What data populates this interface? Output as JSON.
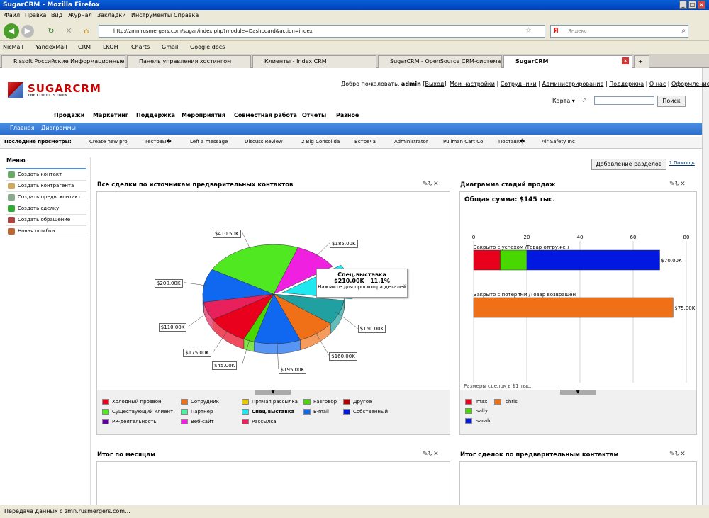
{
  "window": {
    "title": "SugarCRM - Mozilla Firefox"
  },
  "menu": [
    "Файл",
    "Правка",
    "Вид",
    "Журнал",
    "Закладки",
    "Инструменты",
    "Справка"
  ],
  "address": {
    "url": "http://zmn.rusmergers.com/sugar/index.php?module=Dashboard&action=index",
    "search_placeholder": "Яндекс"
  },
  "bookmarks": [
    "NicMail",
    "YandexMail",
    "CRM",
    "LKOH",
    "Charts",
    "Gmail",
    "Google docs"
  ],
  "tabs": [
    "Rissoft Российские Информационные ...",
    "Панель управления хостингом",
    "Клиенты - Index.CRM",
    "SugarCRM - OpenSource CRM-система",
    "SugarCRM"
  ],
  "header": {
    "logo_text": "SUGARCRM",
    "logo_tagline": "THE CLOUD IS OPEN",
    "welcome": "Добро пожаловать, ",
    "user": "admin",
    "logout": "Выход",
    "links": [
      "Мои настройки",
      "Сотрудники",
      "Администрирование",
      "Поддержка",
      "О нас",
      "Оформление"
    ],
    "map_label": "Карта",
    "search_button": "Поиск"
  },
  "mainnav": [
    "Продажи",
    "Маркетинг",
    "Поддержка",
    "Мероприятия",
    "Совместная работа",
    "Отчеты",
    "Разное"
  ],
  "subnav": [
    "Главная",
    "Диаграммы"
  ],
  "recent": {
    "label": "Последние просмотры:",
    "items": [
      "Create new proj",
      "Тестовы�",
      "Left a message",
      "Discuss Review",
      "2 Big Consolida",
      "Встреча",
      "Administrator",
      "Pullman Cart Co",
      "Поставк�",
      "Air Safety Inc"
    ]
  },
  "sidebar": {
    "title": "Меню",
    "items": [
      "Создать контакт",
      "Создать контрагента",
      "Создать предв. контакт",
      "Создать сделку",
      "Создать обращение",
      "Новая ошибка"
    ]
  },
  "dashboard": {
    "add_button": "Добавление разделов",
    "help_link": "Помощь",
    "panel1_title": "Все сделки по источникам предварительных контактов",
    "panel2_title": "Диаграмма стадий продаж",
    "panel3_title": "Итог по месяцам",
    "panel4_title": "Итог сделок по предварительным контактам",
    "total": "Общая сумма: $145 тыс.",
    "size_note": "Размеры сделок в $1 тыс.",
    "tooltip": {
      "title": "Спец.выставка",
      "value": "$210.00K",
      "pct": "11.1%",
      "hint": "Нажмите для просмотра деталей"
    }
  },
  "pie_legend": [
    {
      "label": "Холодный прозвон",
      "color": "#e8001c"
    },
    {
      "label": "Сотрудник",
      "color": "#f07018"
    },
    {
      "label": "Прямая рассылка",
      "color": "#e8c800"
    },
    {
      "label": "Разговор",
      "color": "#48d800"
    },
    {
      "label": "Другое",
      "color": "#b80000"
    },
    {
      "label": "Существующий клиент",
      "color": "#50e820"
    },
    {
      "label": "Партнер",
      "color": "#50f0a0"
    },
    {
      "label": "Спец.выставка",
      "color": "#20e8f0"
    },
    {
      "label": "E-mail",
      "color": "#1068f0"
    },
    {
      "label": "Собственный",
      "color": "#0018e0"
    },
    {
      "label": "PR-деятельность",
      "color": "#6000a0"
    },
    {
      "label": "Веб-сайт",
      "color": "#f020e0"
    },
    {
      "label": "Рассылка",
      "color": "#e8205c"
    }
  ],
  "bar_legend": [
    {
      "label": "max",
      "color": "#e8001c"
    },
    {
      "label": "chris",
      "color": "#f07018"
    },
    {
      "label": "sally",
      "color": "#48d800"
    },
    {
      "label": "sarah",
      "color": "#0018e0"
    }
  ],
  "chart_data": [
    {
      "type": "pie",
      "title": "Все сделки по источникам предварительных контактов",
      "slices": [
        {
          "label": "$185.00K",
          "value": 185,
          "color": "#f020e0"
        },
        {
          "label": "$210.00K",
          "value": 210,
          "color": "#20e8f0"
        },
        {
          "label": "$150.00K",
          "value": 150,
          "color": "#20a0a0"
        },
        {
          "label": "$160.00K",
          "value": 160,
          "color": "#f07018"
        },
        {
          "label": "$195.00K",
          "value": 195,
          "color": "#1068f0"
        },
        {
          "label": "$45.00K",
          "value": 45,
          "color": "#48d800"
        },
        {
          "label": "$175.00K",
          "value": 175,
          "color": "#e8001c"
        },
        {
          "label": "$110.00K",
          "value": 110,
          "color": "#e8205c"
        },
        {
          "label": "$200.00K",
          "value": 200,
          "color": "#1068f0"
        },
        {
          "label": "$410.50K",
          "value": 410.5,
          "color": "#50e820"
        }
      ]
    },
    {
      "type": "bar",
      "title": "Диаграмма стадий продаж",
      "xlim": [
        0,
        80
      ],
      "xticks": [
        "0",
        "20",
        "40",
        "60",
        "80"
      ],
      "categories": [
        "Закрыто с успехом /Товар отгружен",
        "Закрыто с потерями /Товар возвращен"
      ],
      "series": [
        {
          "name": "max",
          "values": [
            10,
            0
          ],
          "color": "#e8001c"
        },
        {
          "name": "sally",
          "values": [
            10,
            0
          ],
          "color": "#48d800"
        },
        {
          "name": "sarah",
          "values": [
            50,
            0
          ],
          "color": "#0018e0"
        },
        {
          "name": "chris",
          "values": [
            0,
            75
          ],
          "color": "#f07018"
        }
      ],
      "totals": [
        "$70.00K",
        "$75.00K"
      ]
    }
  ],
  "status": "Передача данных с zmn.rusmergers.com..."
}
